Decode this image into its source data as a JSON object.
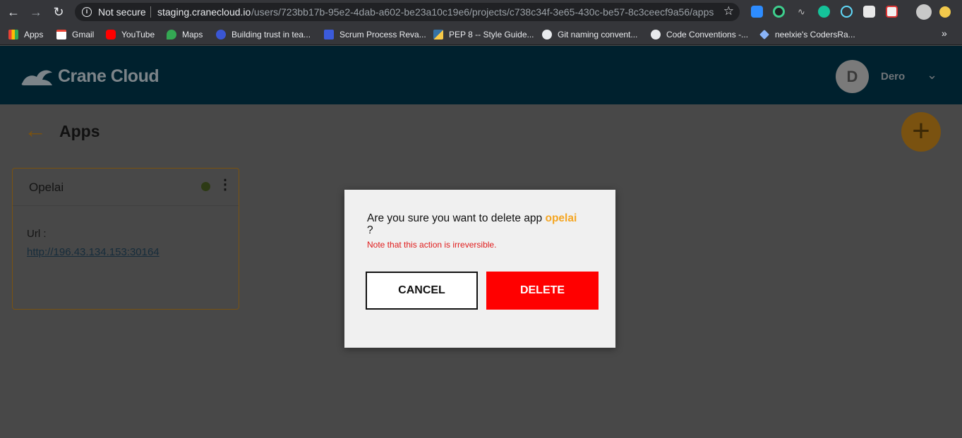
{
  "browser": {
    "not_secure": "Not secure",
    "url_host": "staging.cranecloud.io",
    "url_path": "/users/723bb17b-95e2-4dab-a602-be23a10c19e6/projects/c738c34f-3e65-430c-be57-8c3ceecf9a56/apps",
    "bookmarks": [
      {
        "label": "Apps",
        "icon": "apps-grid-icon",
        "color": "#e94235"
      },
      {
        "label": "Gmail",
        "icon": "gmail-icon",
        "color": "#ea4335"
      },
      {
        "label": "YouTube",
        "icon": "youtube-icon",
        "color": "#ff0000"
      },
      {
        "label": "Maps",
        "icon": "maps-icon",
        "color": "#34a853"
      },
      {
        "label": "Building trust in tea...",
        "icon": "site-icon",
        "color": "#3a56d4"
      },
      {
        "label": "Scrum Process Reva...",
        "icon": "scrum-icon",
        "color": "#3b5bdb"
      },
      {
        "label": "PEP 8 -- Style Guide...",
        "icon": "python-icon",
        "color": "#f7c948"
      },
      {
        "label": "Git naming convent...",
        "icon": "github-icon",
        "color": "#e8eaed"
      },
      {
        "label": "Code Conventions -...",
        "icon": "github-icon",
        "color": "#e8eaed"
      },
      {
        "label": "neelxie's CodersRa...",
        "icon": "codersrank-icon",
        "color": "#8ab4f8"
      }
    ],
    "more_bookmarks": "»"
  },
  "header": {
    "logo_text": "Crane Cloud",
    "avatar_initial": "D",
    "user_name": "Dero"
  },
  "page": {
    "title": "Apps",
    "fab_symbol": "+"
  },
  "app_card": {
    "name": "Opelai",
    "url_label": "Url :",
    "url": "http://196.43.134.153:30164",
    "status_color": "#2d3a15"
  },
  "modal": {
    "question": "Are you sure you want to delete app",
    "app_name": "opelai",
    "question_end": "?",
    "note": "Note that this action is irreversible.",
    "cancel_label": "CANCEL",
    "delete_label": "DELETE"
  },
  "colors": {
    "accent": "#f5a623",
    "danger": "#ff0000",
    "header_bg": "#00212e"
  }
}
